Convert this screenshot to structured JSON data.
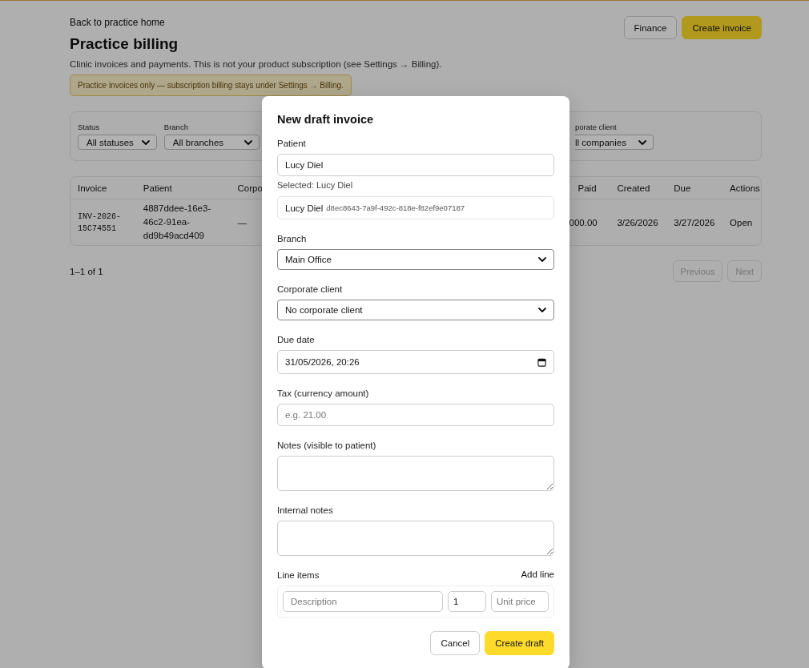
{
  "page": {
    "back_link": "Back to practice home",
    "title": "Practice billing",
    "subtitle": "Clinic invoices and payments. This is not your product subscription (see Settings → Billing).",
    "notice": "Practice invoices only — subscription billing stays under Settings → Billing.",
    "buttons": [
      {
        "label": "Finance",
        "kind": "secondary"
      },
      {
        "label": "Create invoice",
        "kind": "primary"
      }
    ]
  },
  "filters": [
    {
      "label": "Status",
      "value": "All statuses"
    },
    {
      "label": "Branch",
      "value": "All branches"
    },
    {
      "label": "porate client",
      "value": "ll companies"
    }
  ],
  "table": {
    "columns": [
      "Invoice",
      "Patient",
      "Corpo",
      "Paid",
      "Created",
      "Due",
      "Actions"
    ],
    "rows": [
      {
        "cells": [
          "INV-2026-15C74551",
          "4887ddee-16e3-46c2-91ea-dd9b49acd409",
          "—",
          "000.00",
          "3/26/2026",
          "3/27/2026",
          "Open"
        ]
      }
    ]
  },
  "pagination": {
    "summary": "1–1 of 1",
    "buttons": [
      {
        "label": "Previous",
        "disabled": true
      },
      {
        "label": "Next",
        "disabled": true
      }
    ]
  },
  "dialog": {
    "title": "New draft invoice",
    "fields": [
      {
        "kind": "search",
        "label": "Patient",
        "value": "Lucy Diel",
        "note": "Selected: Lucy Diel",
        "option": {
          "name": "Lucy Diel",
          "id": "d8ec8643-7a9f-492c-818e-f82ef9e07187"
        }
      },
      {
        "kind": "select",
        "label": "Branch",
        "value": "Main Office"
      },
      {
        "kind": "select",
        "label": "Corporate client",
        "value": "No corporate client"
      },
      {
        "kind": "datetime",
        "label": "Due date",
        "value": "31/05/2026, 20:26"
      },
      {
        "kind": "text",
        "label": "Tax (currency amount)",
        "placeholder": "e.g. 21.00"
      },
      {
        "kind": "textarea",
        "label": "Notes (visible to patient)"
      },
      {
        "kind": "textarea",
        "label": "Internal notes"
      }
    ],
    "line_items": {
      "label": "Line items",
      "add": "Add line",
      "rows": [
        {
          "description_placeholder": "Description",
          "quantity": "1",
          "price_placeholder": "Unit price"
        }
      ]
    },
    "buttons": [
      {
        "label": "Cancel",
        "kind": "secondary"
      },
      {
        "label": "Create draft",
        "kind": "primary"
      }
    ]
  }
}
